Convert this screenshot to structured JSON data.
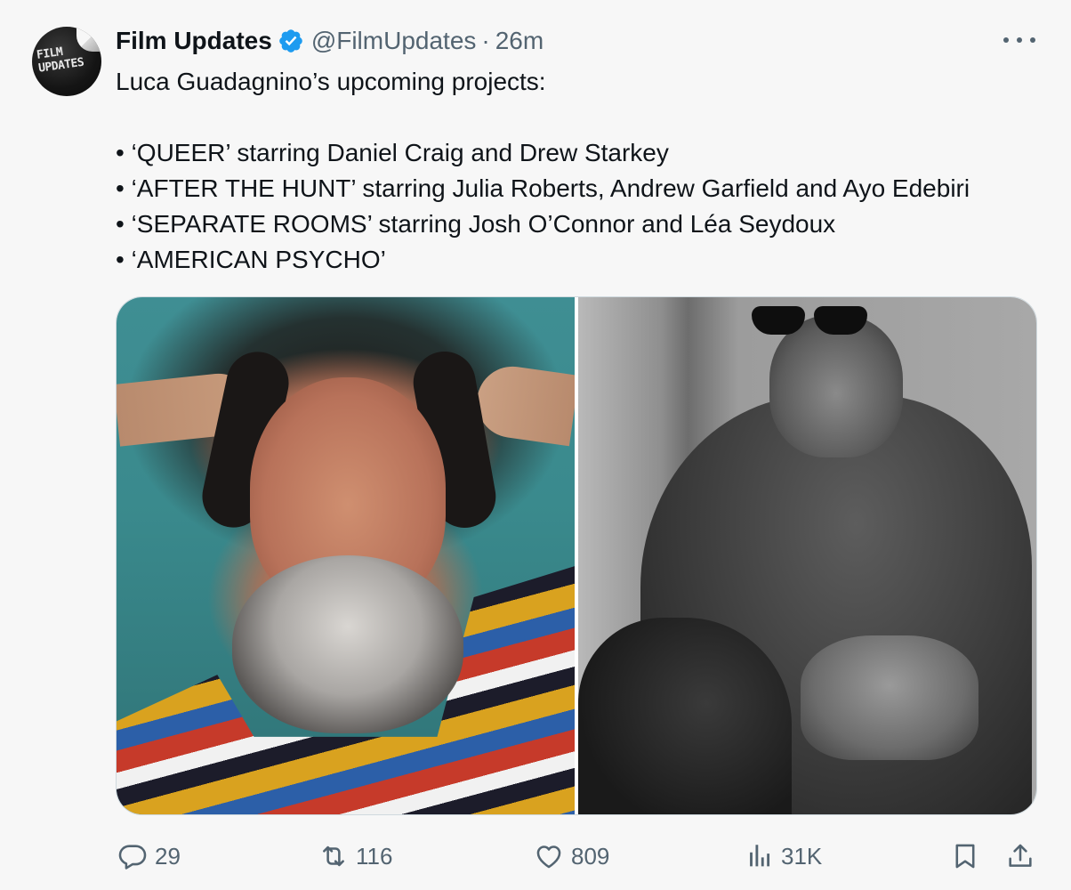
{
  "author": {
    "display_name": "Film Updates",
    "handle": "@FilmUpdates",
    "separator": "·",
    "time": "26m",
    "avatar_logo_line1": "FILM",
    "avatar_logo_line2": "UPDATES",
    "verified_color": "#1d9bf0"
  },
  "tweet": {
    "intro": "Luca Guadagnino’s upcoming projects:",
    "bullets": [
      "• ‘QUEER’ starring Daniel Craig and Drew Starkey",
      "• ‘AFTER THE HUNT’ starring Julia Roberts, Andrew Garfield and Ayo Edebiri",
      "• ‘SEPARATE ROOMS’ starring Josh O’Connor and Léa Seydoux",
      "• ‘AMERICAN PSYCHO’"
    ]
  },
  "actions": {
    "replies": "29",
    "retweets": "116",
    "likes": "809",
    "views": "31K"
  },
  "icons": {
    "reply": "reply-icon",
    "retweet": "retweet-icon",
    "like": "heart-icon",
    "views": "views-icon",
    "bookmark": "bookmark-icon",
    "share": "share-icon",
    "more": "more-icon",
    "verified": "verified-badge-icon"
  },
  "colors": {
    "text": "#0f1419",
    "secondary": "#536471",
    "background": "#f7f7f7",
    "verified": "#1d9bf0"
  }
}
